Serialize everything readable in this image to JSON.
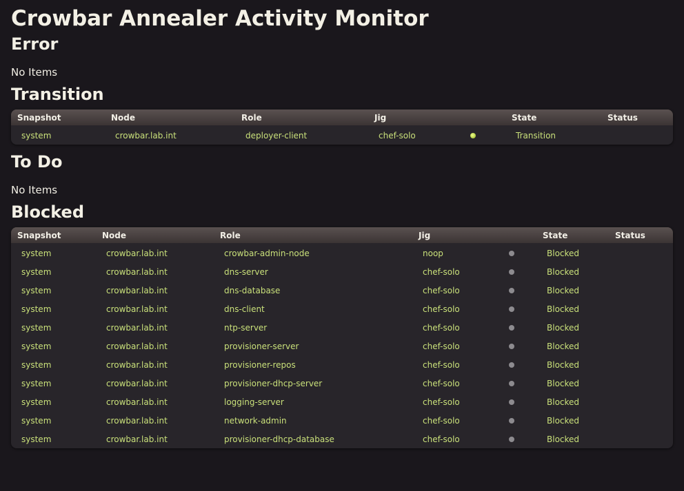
{
  "page": {
    "title": "Crowbar Annealer Activity Monitor"
  },
  "sections": {
    "error": {
      "title": "Error",
      "empty_text": "No Items"
    },
    "transition": {
      "title": "Transition"
    },
    "todo": {
      "title": "To Do",
      "empty_text": "No Items"
    },
    "blocked": {
      "title": "Blocked"
    }
  },
  "columns": {
    "snapshot": "Snapshot",
    "node": "Node",
    "role": "Role",
    "jig": "Jig",
    "indicator": "",
    "state": "State",
    "status": "Status"
  },
  "colors": {
    "background": "#1a171c",
    "panel": "#28252a",
    "cell_text": "#c9e07a",
    "indicator_active": "#a8c83a",
    "indicator_idle": "#8d8b8f"
  },
  "transition_rows": [
    {
      "snapshot": "system",
      "node": "crowbar.lab.int",
      "role": "deployer-client",
      "jig": "chef-solo",
      "indicator": "green-dot",
      "state": "Transition",
      "status": ""
    }
  ],
  "blocked_rows": [
    {
      "snapshot": "system",
      "node": "crowbar.lab.int",
      "role": "crowbar-admin-node",
      "jig": "noop",
      "indicator": "grey-dot",
      "state": "Blocked",
      "status": ""
    },
    {
      "snapshot": "system",
      "node": "crowbar.lab.int",
      "role": "dns-server",
      "jig": "chef-solo",
      "indicator": "grey-dot",
      "state": "Blocked",
      "status": ""
    },
    {
      "snapshot": "system",
      "node": "crowbar.lab.int",
      "role": "dns-database",
      "jig": "chef-solo",
      "indicator": "grey-dot",
      "state": "Blocked",
      "status": ""
    },
    {
      "snapshot": "system",
      "node": "crowbar.lab.int",
      "role": "dns-client",
      "jig": "chef-solo",
      "indicator": "grey-dot",
      "state": "Blocked",
      "status": ""
    },
    {
      "snapshot": "system",
      "node": "crowbar.lab.int",
      "role": "ntp-server",
      "jig": "chef-solo",
      "indicator": "grey-dot",
      "state": "Blocked",
      "status": ""
    },
    {
      "snapshot": "system",
      "node": "crowbar.lab.int",
      "role": "provisioner-server",
      "jig": "chef-solo",
      "indicator": "grey-dot",
      "state": "Blocked",
      "status": ""
    },
    {
      "snapshot": "system",
      "node": "crowbar.lab.int",
      "role": "provisioner-repos",
      "jig": "chef-solo",
      "indicator": "grey-dot",
      "state": "Blocked",
      "status": ""
    },
    {
      "snapshot": "system",
      "node": "crowbar.lab.int",
      "role": "provisioner-dhcp-server",
      "jig": "chef-solo",
      "indicator": "grey-dot",
      "state": "Blocked",
      "status": ""
    },
    {
      "snapshot": "system",
      "node": "crowbar.lab.int",
      "role": "logging-server",
      "jig": "chef-solo",
      "indicator": "grey-dot",
      "state": "Blocked",
      "status": ""
    },
    {
      "snapshot": "system",
      "node": "crowbar.lab.int",
      "role": "network-admin",
      "jig": "chef-solo",
      "indicator": "grey-dot",
      "state": "Blocked",
      "status": ""
    },
    {
      "snapshot": "system",
      "node": "crowbar.lab.int",
      "role": "provisioner-dhcp-database",
      "jig": "chef-solo",
      "indicator": "grey-dot",
      "state": "Blocked",
      "status": ""
    }
  ]
}
